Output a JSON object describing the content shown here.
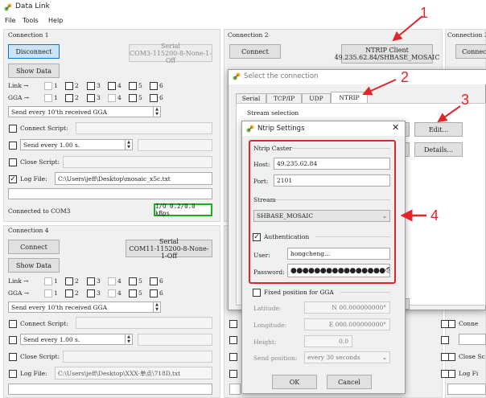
{
  "app": {
    "title": "Data Link",
    "menu": [
      "File",
      "Tools",
      "Help"
    ]
  },
  "conn1": {
    "title": "Connection 1",
    "disconnect_label": "Disconnect",
    "info_line1": "Serial",
    "info_line2": "COM3-115200-8-None-1-Off",
    "show_data_label": "Show Data",
    "link_label": "Link →",
    "gga_label": "GGA →",
    "nums": [
      "1",
      "2",
      "3",
      "4",
      "5",
      "6"
    ],
    "send_gga": "Send every 10'th received GGA",
    "connect_script_label": "Connect Script:",
    "send_every": "Send every 1.00 s.",
    "close_script_label": "Close Script:",
    "log_file_label": "Log File:",
    "log_path": "C:\\Users\\jeff\\Desktop\\mosaic_x5c.txt",
    "status": "Connected to COM3",
    "io": "I/O 0.2/0.0 kBps"
  },
  "conn2": {
    "title": "Connection 2",
    "connect_label": "Connect",
    "info_line1": "NTRIP Client",
    "info_line2": "49.235.62.84/SHBASE_MOSAIC"
  },
  "conn3": {
    "title": "Connection 3",
    "connect_label": "Connect",
    "connect_script_short": "Conne",
    "close_script_short": "Close Sc",
    "log_file_short": "Log Fi"
  },
  "conn4": {
    "title": "Connection 4",
    "connect_label": "Connect",
    "info_line1": "Serial",
    "info_line2": "COM11-115200-8-None-1-Off",
    "show_data_label": "Show Data",
    "link_label": "Link →",
    "gga_label": "GGA →",
    "nums": [
      "1",
      "2",
      "3",
      "4",
      "5",
      "6"
    ],
    "send_gga": "Send every 10'th received GGA",
    "connect_script_label": "Connect Script:",
    "send_every": "Send every 1.00 s.",
    "close_script_label": "Close Script:",
    "log_file_label": "Log File:",
    "log_path": "C:\\Users\\jeff\\Desktop\\XXX-单点\\718D.txt"
  },
  "select_dialog": {
    "title": "Select the connection",
    "tabs": [
      "Serial",
      "TCP/IP",
      "UDP",
      "NTRIP"
    ],
    "stream_selection": "Stream selection",
    "edit_label": "Edit...",
    "details_label": "Details..."
  },
  "ntrip": {
    "title": "Ntrip Settings",
    "caster_label": "Ntrip Caster",
    "host_label": "Host:",
    "host": "49.235.62.84",
    "port_label": "Port:",
    "port": "2101",
    "stream_label": "Stream",
    "stream": "SHBASE_MOSAIC",
    "auth_label": "Authentication",
    "user_label": "User:",
    "user": "hongcheng...",
    "password_label": "Password:",
    "password": "●●●●●●●●●●●●●●●●",
    "fixed_pos_label": "Fixed position for GGA",
    "latitude_label": "Latitude:",
    "latitude": "N 00.000000000°",
    "longitude_label": "Longitude:",
    "longitude": "E 000.000000000°",
    "height_label": "Height:",
    "height": "0.0",
    "send_position_label": "Send position:",
    "send_position": "every 30 seconds",
    "ok_label": "OK",
    "cancel_label": "Cancel"
  },
  "annotations": [
    "1",
    "2",
    "3",
    "4"
  ],
  "colors": {
    "accent_red": "#e0262a",
    "io_green": "#22aa22",
    "disconnect_blue": "#cce4f7"
  }
}
